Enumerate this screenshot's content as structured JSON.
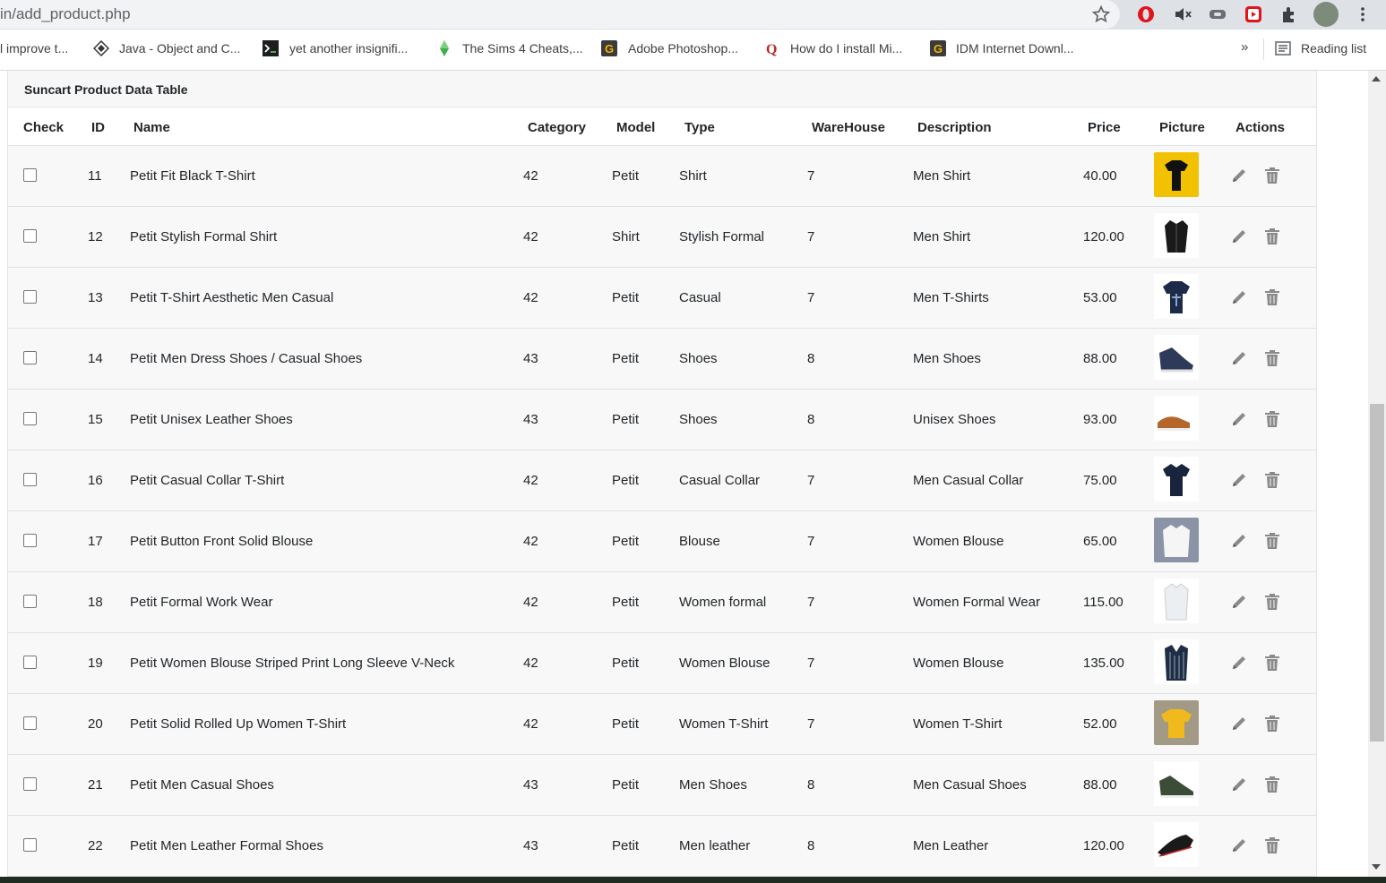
{
  "browser": {
    "url": "in/add_product.php",
    "bookmarks": [
      {
        "label": "l improve t...",
        "icon": "none"
      },
      {
        "label": "Java - Object and C...",
        "icon": "diamond-icon"
      },
      {
        "label": "yet another insignifi...",
        "icon": "terminal-icon"
      },
      {
        "label": "The Sims 4 Cheats,...",
        "icon": "plumbob-icon"
      },
      {
        "label": "Adobe Photoshop...",
        "icon": "g-logo-icon"
      },
      {
        "label": "How do I install Mi...",
        "icon": "quora-icon"
      },
      {
        "label": "IDM Internet Downl...",
        "icon": "g-logo-icon"
      }
    ],
    "overflow_label": "»",
    "reading_list_label": "Reading list"
  },
  "card": {
    "title": "Suncart Product Data Table"
  },
  "table": {
    "columns": [
      "Check",
      "ID",
      "Name",
      "Category",
      "Model",
      "Type",
      "WareHouse",
      "Description",
      "Price",
      "Picture",
      "Actions"
    ],
    "rows": [
      {
        "id": "11",
        "name": "Petit Fit Black T-Shirt",
        "category": "42",
        "model": "Petit",
        "type": "Shirt",
        "warehouse": "7",
        "description": "Men Shirt",
        "price": "40.00",
        "picture": "black-tshirt"
      },
      {
        "id": "12",
        "name": "Petit Stylish Formal Shirt",
        "category": "42",
        "model": "Shirt",
        "type": "Stylish Formal",
        "warehouse": "7",
        "description": "Men Shirt",
        "price": "120.00",
        "picture": "black-formal-shirt"
      },
      {
        "id": "13",
        "name": "Petit T-Shirt Aesthetic Men Casual",
        "category": "42",
        "model": "Petit",
        "type": "Casual",
        "warehouse": "7",
        "description": "Men T-Shirts",
        "price": "53.00",
        "picture": "navy-tshirt"
      },
      {
        "id": "14",
        "name": "Petit Men Dress Shoes / Casual Shoes",
        "category": "43",
        "model": "Petit",
        "type": "Shoes",
        "warehouse": "8",
        "description": "Men Shoes",
        "price": "88.00",
        "picture": "blue-sneaker"
      },
      {
        "id": "15",
        "name": "Petit Unisex Leather Shoes",
        "category": "43",
        "model": "Petit",
        "type": "Shoes",
        "warehouse": "8",
        "description": "Unisex Shoes",
        "price": "93.00",
        "picture": "brown-shoe"
      },
      {
        "id": "16",
        "name": "Petit Casual Collar T-Shirt",
        "category": "42",
        "model": "Petit",
        "type": "Casual Collar",
        "warehouse": "7",
        "description": "Men Casual Collar",
        "price": "75.00",
        "picture": "navy-polo"
      },
      {
        "id": "17",
        "name": "Petit Button Front Solid Blouse",
        "category": "42",
        "model": "Petit",
        "type": "Blouse",
        "warehouse": "7",
        "description": "Women Blouse",
        "price": "65.00",
        "picture": "white-blouse"
      },
      {
        "id": "18",
        "name": "Petit Formal Work Wear",
        "category": "42",
        "model": "Petit",
        "type": "Women formal",
        "warehouse": "7",
        "description": "Women Formal Wear",
        "price": "115.00",
        "picture": "white-formal"
      },
      {
        "id": "19",
        "name": "Petit Women Blouse Striped Print Long Sleeve V-Neck",
        "category": "42",
        "model": "Petit",
        "type": "Women Blouse",
        "warehouse": "7",
        "description": "Women Blouse",
        "price": "135.00",
        "picture": "striped-blouse"
      },
      {
        "id": "20",
        "name": "Petit Solid Rolled Up Women T-Shirt",
        "category": "42",
        "model": "Petit",
        "type": "Women T-Shirt",
        "warehouse": "7",
        "description": "Women T-Shirt",
        "price": "52.00",
        "picture": "yellow-tshirt"
      },
      {
        "id": "21",
        "name": "Petit Men Casual Shoes",
        "category": "43",
        "model": "Petit",
        "type": "Men Shoes",
        "warehouse": "8",
        "description": "Men Casual Shoes",
        "price": "88.00",
        "picture": "green-shoe"
      },
      {
        "id": "22",
        "name": "Petit Men Leather Formal Shoes",
        "category": "43",
        "model": "Petit",
        "type": "Men leather",
        "warehouse": "8",
        "description": "Men Leather",
        "price": "120.00",
        "picture": "black-leather-shoe"
      }
    ]
  },
  "colors": {
    "row_bg": "#f8f8f8",
    "icon_grey": "#8a8a8a"
  }
}
